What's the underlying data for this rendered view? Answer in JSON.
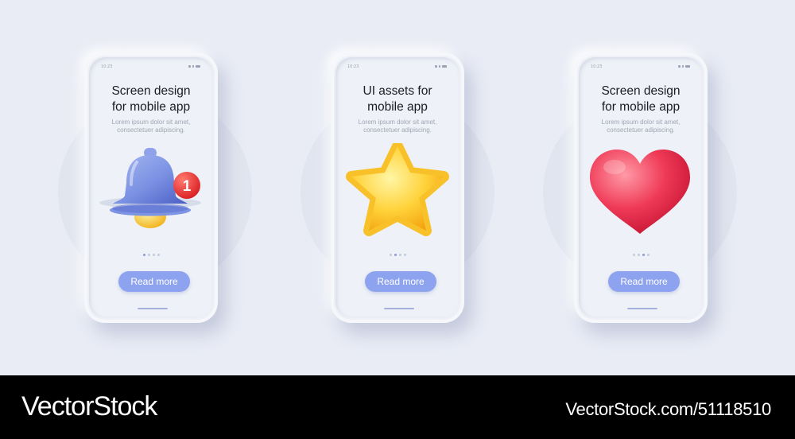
{
  "cards": [
    {
      "time": "10:23",
      "title_line1": "Screen design",
      "title_line2": "for mobile app",
      "body_line1": "Lorem ipsum dolor sit amet,",
      "body_line2": "consectetuer adipiscing.",
      "illustration": "bell-icon",
      "badge_count": "1",
      "active_page": 1,
      "button_label": "Read more"
    },
    {
      "time": "10:23",
      "title_line1": "UI assets for",
      "title_line2": "mobile app",
      "body_line1": "Lorem ipsum dolor sit amet,",
      "body_line2": "consectetuer adipiscing.",
      "illustration": "star-icon",
      "active_page": 2,
      "button_label": "Read more"
    },
    {
      "time": "10:23",
      "title_line1": "Screen design",
      "title_line2": "for mobile app",
      "body_line1": "Lorem ipsum dolor sit amet,",
      "body_line2": "consectetuer adipiscing.",
      "illustration": "heart-icon",
      "active_page": 3,
      "button_label": "Read more"
    }
  ],
  "pager_total": 4,
  "colors": {
    "background": "#e9ecf5",
    "button": "#8ea3ef",
    "bell": "#7c93e4",
    "star": "#ffc21a",
    "heart": "#e8304f",
    "badge": "#ef2a2a"
  },
  "footer": {
    "brand": "VectorStock",
    "credit": "VectorStock.com/51118510"
  }
}
